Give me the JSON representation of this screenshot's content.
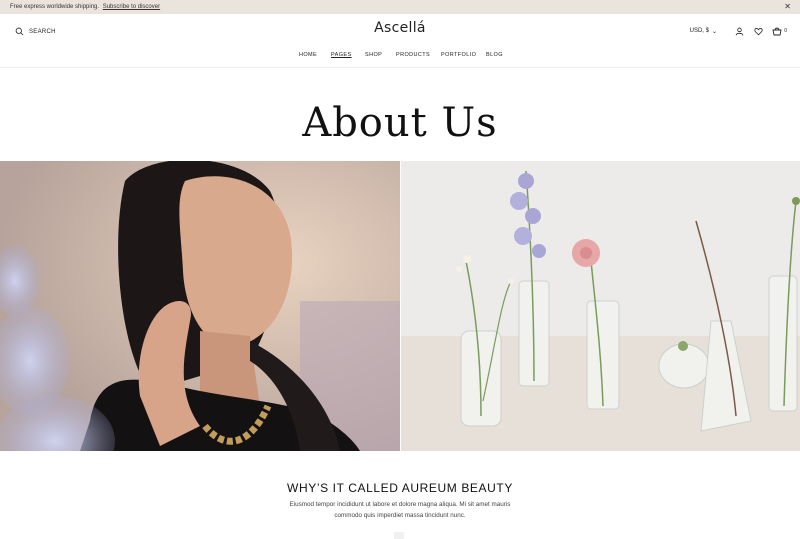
{
  "announcement": {
    "message": "Free express worldwide shipping.",
    "link_label": "Subscribe to discover",
    "close_icon": "close-icon"
  },
  "header": {
    "search_label": "SEARCH",
    "logo": "Ascellá",
    "currency": "USD, $",
    "cart_count": "0",
    "icons": [
      "search-icon",
      "user-icon",
      "heart-icon",
      "cart-icon"
    ]
  },
  "nav": {
    "items": [
      {
        "label": "HOME"
      },
      {
        "label": "PAGES"
      },
      {
        "label": "SHOP"
      },
      {
        "label": "PRODUCTS"
      },
      {
        "label": "PORTFOLIO"
      },
      {
        "label": "BLOG"
      }
    ],
    "active": "PAGES"
  },
  "hero": {
    "title": "About Us"
  },
  "section": {
    "title": "WHY’S IT CALLED AUREUM BEAUTY",
    "text": "Eiusmod tempor incididunt ut labore et dolore magna aliqua. Mi sit amet mauris commodo quis imperdiet massa tincidunt nunc."
  },
  "colors": {
    "announcement_bg": "#ebe4dc",
    "text": "#222222",
    "background": "#ffffff"
  }
}
